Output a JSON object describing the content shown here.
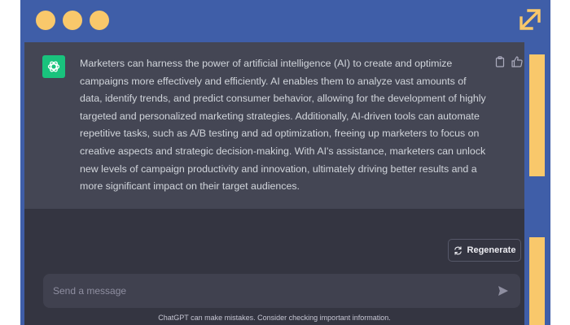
{
  "window": {
    "controls": [
      "red-dot",
      "yellow-dot",
      "green-dot"
    ],
    "expand_icon": "expand-arrows-icon",
    "frame_color": "#3f5ea8",
    "accent_color": "#f9c86b"
  },
  "message": {
    "avatar_icon": "chatgpt-logo-icon",
    "avatar_color": "#19c37d",
    "text": "Marketers can harness the power of artificial intelligence (AI) to create and optimize campaigns more effectively and efficiently. AI enables them to analyze vast amounts of data, identify trends, and predict consumer behavior, allowing for the development of highly targeted and personalized marketing strategies. Additionally, AI-driven tools can automate repetitive tasks, such as A/B testing and ad optimization, freeing up marketers to focus on creative aspects and strategic decision-making. With AI's assistance, marketers can unlock new levels of campaign productivity and innovation, ultimately driving better results and a more significant impact on their target audiences.",
    "actions": [
      "copy-icon",
      "thumbs-up-icon"
    ]
  },
  "regenerate": {
    "label": "Regenerate",
    "icon": "refresh-icon"
  },
  "composer": {
    "placeholder": "Send a message",
    "send_icon": "send-icon"
  },
  "disclaimer": "ChatGPT can make mistakes. Consider checking important information."
}
